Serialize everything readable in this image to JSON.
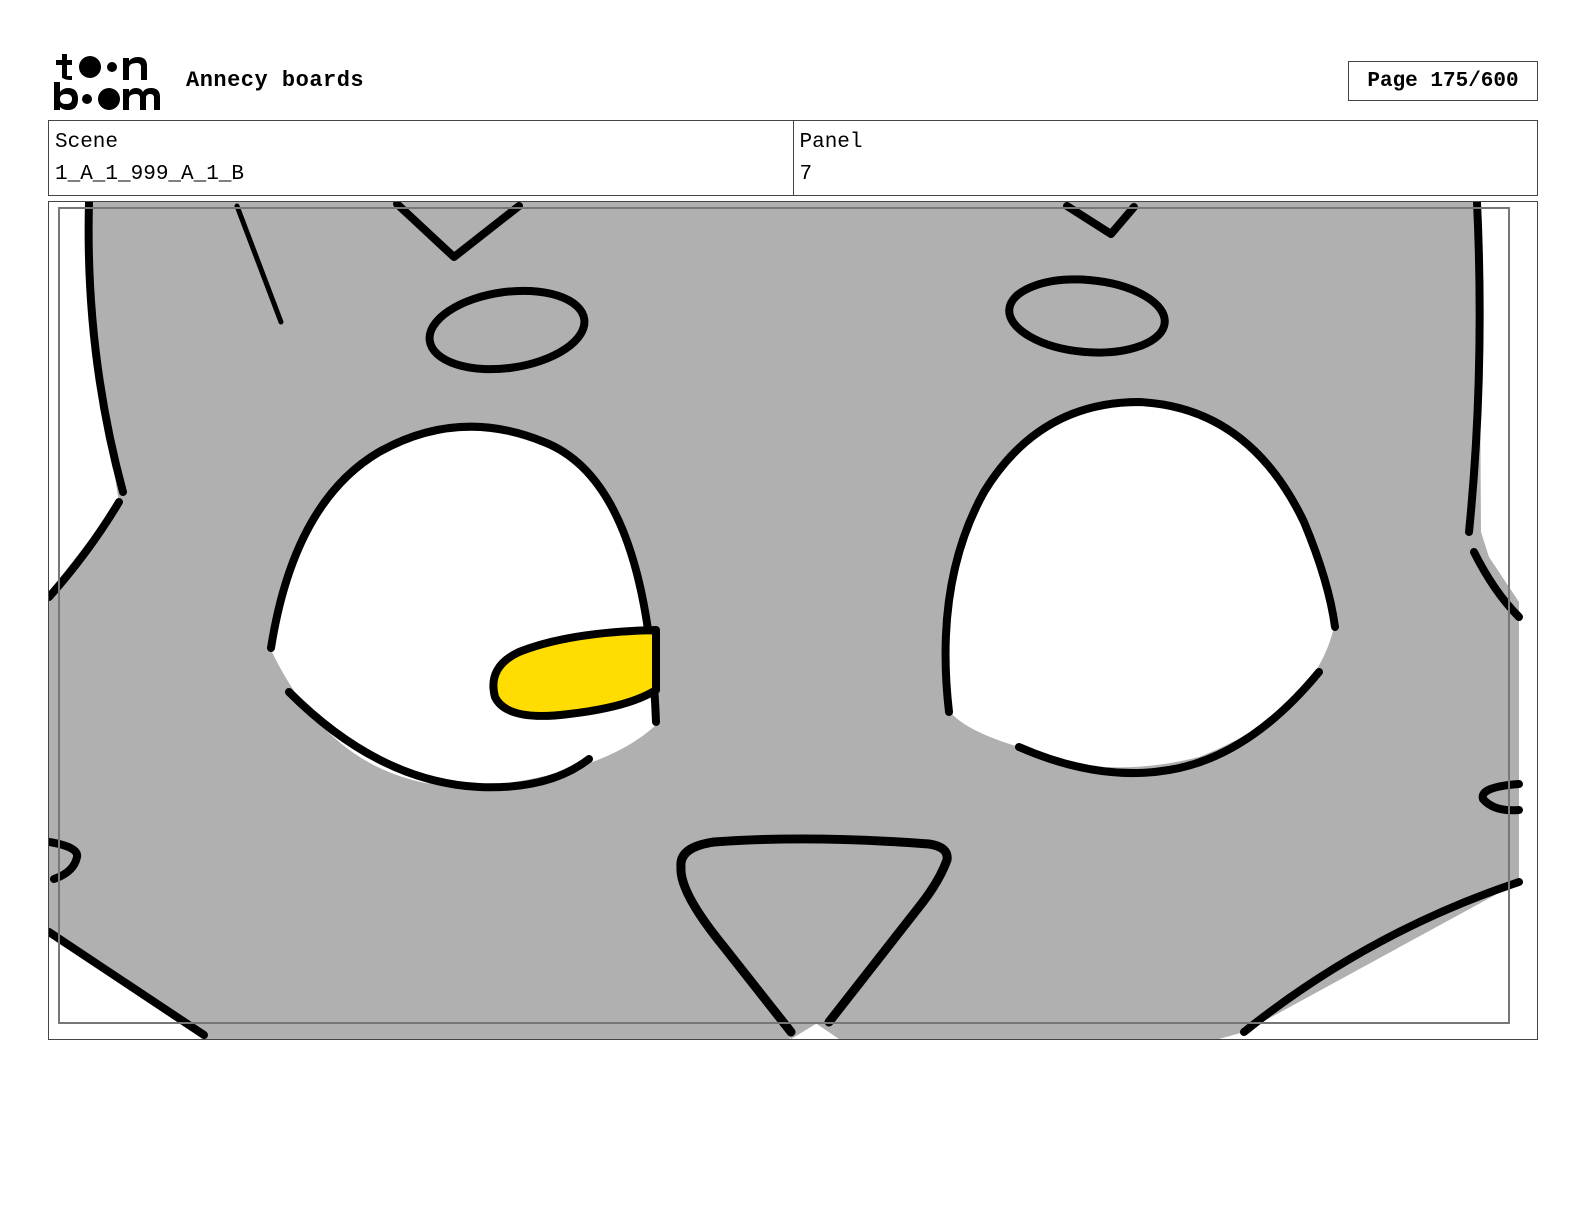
{
  "header": {
    "logo_alt": "toon boom",
    "title": "Annecy boards",
    "page_label": "Page 175/600"
  },
  "info": {
    "scene_label": "Scene",
    "scene_value": "1_A_1_999_A_1_B",
    "panel_label": "Panel",
    "panel_value": "7"
  },
  "colors": {
    "face_fill": "#b0b0b0",
    "outline": "#000000",
    "eye_white": "#ffffff",
    "eye_iris": "#ffdd00",
    "frame_border": "#444444"
  }
}
